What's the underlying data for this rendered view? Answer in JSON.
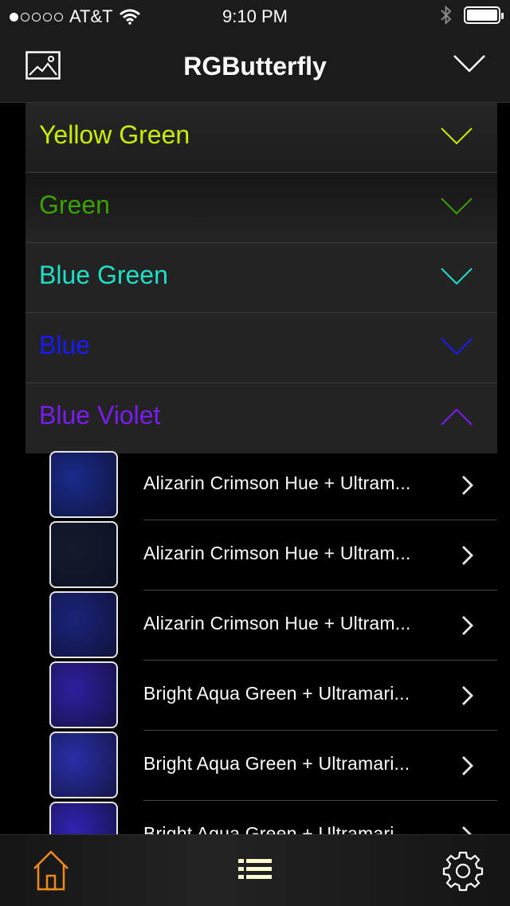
{
  "status_bar": {
    "carrier": "AT&T",
    "time": "9:10 PM",
    "signal_bars_filled": 1,
    "signal_bars_total": 5
  },
  "navbar": {
    "title": "RGButterfly",
    "left_icon": "image-icon",
    "right_icon": "chevron-down-icon"
  },
  "sections": [
    {
      "label": "Yellow Green",
      "color": "#c7f000",
      "expanded": false
    },
    {
      "label": "Green",
      "color": "#3aa100",
      "expanded": false
    },
    {
      "label": "Blue Green",
      "color": "#1ee0c8",
      "expanded": false
    },
    {
      "label": "Blue",
      "color": "#1a1aff",
      "expanded": false
    },
    {
      "label": "Blue Violet",
      "color": "#7a1cf2",
      "expanded": true
    }
  ],
  "items": [
    {
      "label": "Alizarin Crimson Hue + Ultram...",
      "swatch": "#1a2a8a"
    },
    {
      "label": "Alizarin Crimson Hue + Ultram...",
      "swatch": "#141a2c"
    },
    {
      "label": "Alizarin Crimson Hue + Ultram...",
      "swatch": "#1b237a"
    },
    {
      "label": "Bright Aqua Green + Ultramari...",
      "swatch": "#2e1fa0"
    },
    {
      "label": "Bright Aqua Green + Ultramari...",
      "swatch": "#2a2ea8"
    },
    {
      "label": "Bright Aqua Green + Ultramari...",
      "swatch": "#3022b0"
    }
  ],
  "tabbar": {
    "home_icon": "home-icon",
    "list_icon": "list-icon",
    "settings_icon": "gear-icon",
    "home_color": "#f08a1e",
    "icon_color": "#fffbd0"
  }
}
